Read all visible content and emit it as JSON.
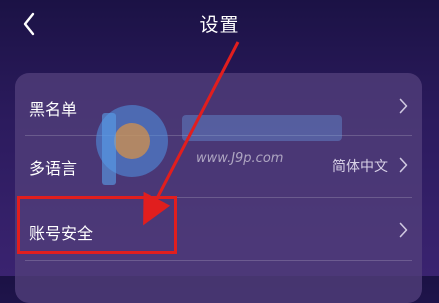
{
  "header": {
    "title": "设置"
  },
  "settings": {
    "items": [
      {
        "label": "黑名单",
        "value": ""
      },
      {
        "label": "多语言",
        "value": "简体中文"
      },
      {
        "label": "账号安全",
        "value": ""
      }
    ]
  },
  "watermark": {
    "url": "www.J9p.com"
  },
  "colors": {
    "background_top": "#1b1245",
    "background_bottom": "#3a2370",
    "card": "#523f7b",
    "highlight": "#e11e1e"
  },
  "icons": {
    "back": "chevron-left-icon",
    "row": "chevron-right-icon"
  }
}
